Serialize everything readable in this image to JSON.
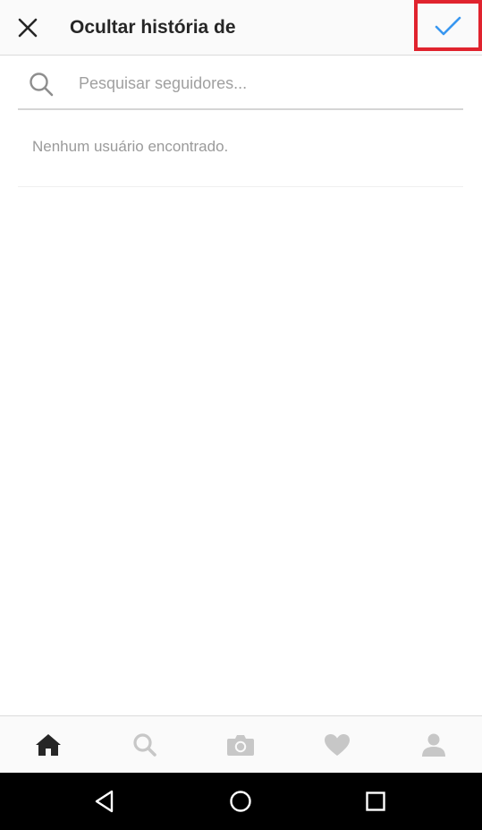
{
  "header": {
    "title": "Ocultar história de",
    "close_icon": "close-icon",
    "confirm_icon": "check-icon",
    "confirm_color": "#3897f0",
    "highlight_color": "#e0232e"
  },
  "search": {
    "placeholder": "Pesquisar seguidores...",
    "value": "",
    "icon": "search-icon"
  },
  "results": {
    "empty_message": "Nenhum usuário encontrado."
  },
  "tabbar": {
    "items": [
      {
        "icon": "home-icon",
        "active": true
      },
      {
        "icon": "search-icon",
        "active": false
      },
      {
        "icon": "camera-icon",
        "active": false
      },
      {
        "icon": "heart-icon",
        "active": false
      },
      {
        "icon": "profile-icon",
        "active": false
      }
    ]
  },
  "system_nav": {
    "items": [
      {
        "icon": "back-icon"
      },
      {
        "icon": "home-circle-icon"
      },
      {
        "icon": "recents-icon"
      }
    ]
  }
}
